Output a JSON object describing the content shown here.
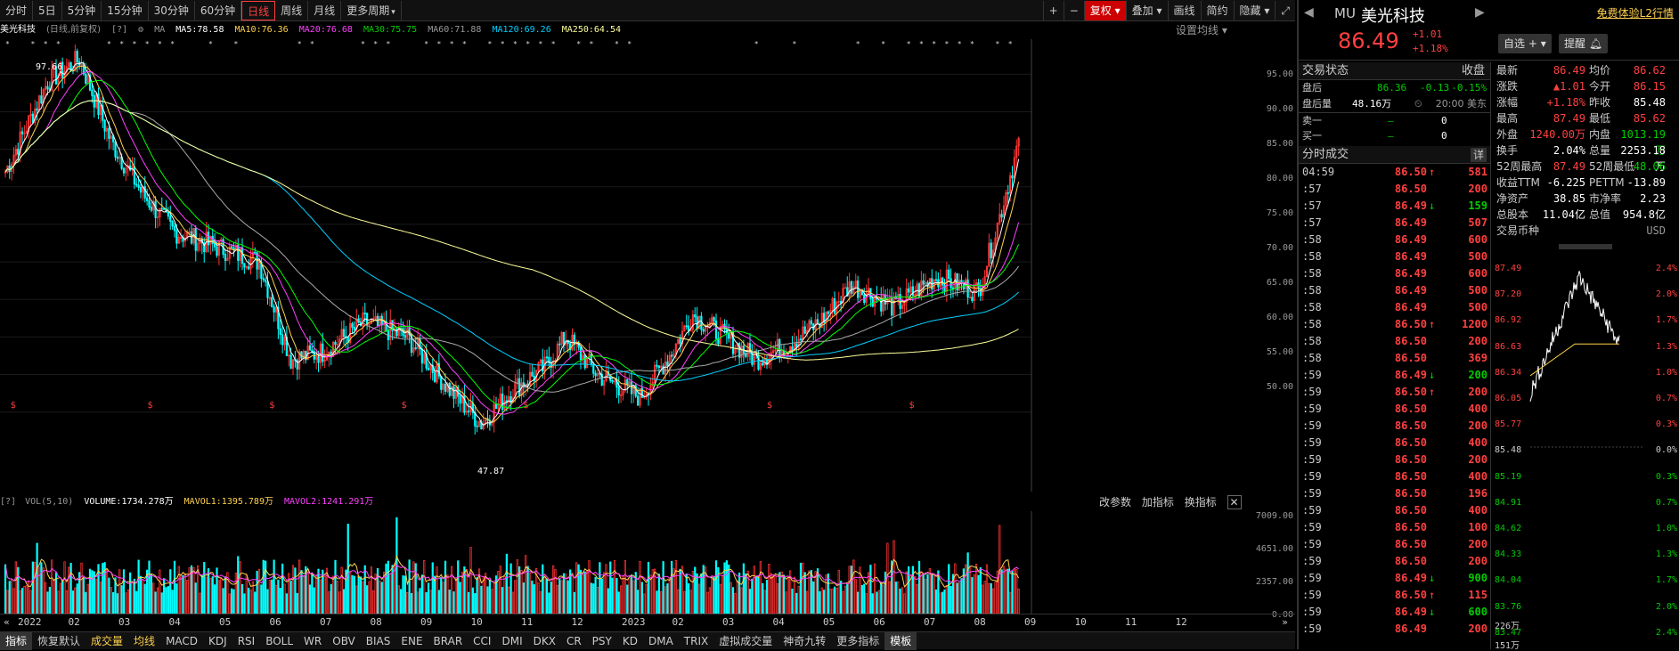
{
  "toolbar": {
    "periods": [
      "分时",
      "5日",
      "5分钟",
      "15分钟",
      "30分钟",
      "60分钟",
      "日线",
      "周线",
      "月线",
      "更多周期"
    ],
    "active_period": "日线",
    "right": [
      "+",
      "−",
      "复权",
      "叠加",
      "画线",
      "简约",
      "隐藏",
      "⤢"
    ]
  },
  "ma_bar": {
    "name": "美光科技",
    "mode": "(日线,前复权)",
    "ma_label": "MA",
    "ma5": "MA5:78.58",
    "ma10": "MA10:76.36",
    "ma20": "MA20:76.68",
    "ma30": "MA30:75.75",
    "ma60": "MA60:71.88",
    "ma120": "MA120:69.26",
    "ma250": "MA250:64.54",
    "settings": "设置均线"
  },
  "colors": {
    "ma5": "#ffffff",
    "ma10": "#ffd24d",
    "ma20": "#ff40ff",
    "ma30": "#00ff00",
    "ma60": "#aaaaaa",
    "ma120": "#00d0ff",
    "ma250": "#ffff99",
    "up": "#ff3333",
    "down": "#00ffff"
  },
  "price_axis": [
    "95.00",
    "90.00",
    "85.00",
    "80.00",
    "75.00",
    "70.00",
    "65.00",
    "60.00",
    "55.00",
    "50.00"
  ],
  "vol_axis": [
    "7009.00",
    "4651.00",
    "2357.00",
    "0.00"
  ],
  "price_annotations": {
    "high": "97.66",
    "low": "47.87"
  },
  "vol_header": {
    "label": "VOL(5,10)",
    "volume": "VOLUME:1734.278万",
    "mavol1": "MAVOL1:1395.789万",
    "mavol2": "MAVOL2:1241.291万",
    "actions": [
      "改参数",
      "加指标",
      "换指标"
    ]
  },
  "x_axis": [
    "2022",
    "02",
    "03",
    "04",
    "05",
    "06",
    "07",
    "08",
    "09",
    "10",
    "11",
    "12",
    "2023",
    "02",
    "03",
    "04",
    "05",
    "06",
    "07",
    "08",
    "09",
    "10",
    "11",
    "12"
  ],
  "bottom_tabs": [
    "指标",
    "恢复默认",
    "成交量",
    "均线",
    "MACD",
    "KDJ",
    "RSI",
    "BOLL",
    "WR",
    "OBV",
    "BIAS",
    "ENE",
    "BRAR",
    "CCI",
    "DMI",
    "DKX",
    "CR",
    "PSY",
    "KD",
    "DMA",
    "TRIX",
    "虚拟成交量",
    "神奇九转",
    "更多指标",
    "模板"
  ],
  "quote": {
    "code": "MU",
    "name": "美光科技",
    "free_trial": "免费体验L2行情",
    "price": "86.49",
    "change": "+1.01",
    "change_pct": "+1.18%",
    "btn_watch": "自选",
    "btn_alert": "提醒",
    "status_title": "交易状态",
    "status_value": "收盘",
    "after_label": "盘后",
    "after_price": "86.36",
    "after_chg": "-0.13",
    "after_pct": "-0.15%",
    "after_vol_label": "盘后量",
    "after_vol": "48.16万",
    "time_note": "20:00 美东",
    "sell1_label": "卖一",
    "sell1_price": "—",
    "sell1_vol": "0",
    "buy1_label": "买一",
    "buy1_price": "—",
    "buy1_vol": "0",
    "trades_title": "分时成交",
    "trades_detail": "详"
  },
  "stats": [
    {
      "l1": "最新",
      "v1": "86.49",
      "c1": "red",
      "l2": "均价",
      "v2": "86.62",
      "c2": "red"
    },
    {
      "l1": "涨跌",
      "v1": "▲1.01",
      "c1": "red",
      "l2": "今开",
      "v2": "86.15",
      "c2": "red"
    },
    {
      "l1": "涨幅",
      "v1": "+1.18%",
      "c1": "red",
      "l2": "昨收",
      "v2": "85.48",
      "c2": "white"
    },
    {
      "l1": "最高",
      "v1": "87.49",
      "c1": "red",
      "l2": "最低",
      "v2": "85.62",
      "c2": "red"
    },
    {
      "l1": "外盘",
      "v1": "1240.00万",
      "c1": "red",
      "l2": "内盘",
      "v2": "1013.19万",
      "c2": "green"
    },
    {
      "l1": "换手",
      "v1": "2.04%",
      "c1": "white",
      "l2": "总量",
      "v2": "2253.18万",
      "c2": "white"
    },
    {
      "l1": "52周最高",
      "v1": "87.49",
      "c1": "red",
      "l2": "52周最低",
      "v2": "48.06",
      "c2": "green"
    },
    {
      "l1": "收益TTM",
      "v1": "-6.225",
      "c1": "white",
      "l2": "PETTM",
      "v2": "-13.89",
      "c2": "white"
    },
    {
      "l1": "净资产",
      "v1": "38.85",
      "c1": "white",
      "l2": "市净率",
      "v2": "2.23",
      "c2": "white"
    },
    {
      "l1": "总股本",
      "v1": "11.04亿",
      "c1": "white",
      "l2": "总值",
      "v2": "954.8亿",
      "c2": "white"
    },
    {
      "l1": "交易币种",
      "v1": "",
      "c1": "white",
      "l2": "",
      "v2": "USD",
      "c2": "gray"
    }
  ],
  "trades": [
    {
      "t": "04:59",
      "p": "86.50",
      "a": "↑",
      "v": "581",
      "c": "red"
    },
    {
      "t": ":57",
      "p": "86.50",
      "a": "",
      "v": "200",
      "c": "red"
    },
    {
      "t": ":57",
      "p": "86.49",
      "a": "↓",
      "v": "159",
      "c": "green"
    },
    {
      "t": ":57",
      "p": "86.49",
      "a": "",
      "v": "507",
      "c": "red"
    },
    {
      "t": ":58",
      "p": "86.49",
      "a": "",
      "v": "600",
      "c": "red"
    },
    {
      "t": ":58",
      "p": "86.49",
      "a": "",
      "v": "500",
      "c": "red"
    },
    {
      "t": ":58",
      "p": "86.49",
      "a": "",
      "v": "600",
      "c": "red"
    },
    {
      "t": ":58",
      "p": "86.49",
      "a": "",
      "v": "500",
      "c": "red"
    },
    {
      "t": ":58",
      "p": "86.49",
      "a": "",
      "v": "500",
      "c": "red"
    },
    {
      "t": ":58",
      "p": "86.50",
      "a": "↑",
      "v": "1200",
      "c": "red"
    },
    {
      "t": ":58",
      "p": "86.50",
      "a": "",
      "v": "200",
      "c": "red"
    },
    {
      "t": ":58",
      "p": "86.50",
      "a": "",
      "v": "369",
      "c": "red"
    },
    {
      "t": ":59",
      "p": "86.49",
      "a": "↓",
      "v": "200",
      "c": "green"
    },
    {
      "t": ":59",
      "p": "86.50",
      "a": "↑",
      "v": "200",
      "c": "red"
    },
    {
      "t": ":59",
      "p": "86.50",
      "a": "",
      "v": "400",
      "c": "red"
    },
    {
      "t": ":59",
      "p": "86.50",
      "a": "",
      "v": "200",
      "c": "red"
    },
    {
      "t": ":59",
      "p": "86.50",
      "a": "",
      "v": "400",
      "c": "red"
    },
    {
      "t": ":59",
      "p": "86.50",
      "a": "",
      "v": "200",
      "c": "red"
    },
    {
      "t": ":59",
      "p": "86.50",
      "a": "",
      "v": "400",
      "c": "red"
    },
    {
      "t": ":59",
      "p": "86.50",
      "a": "",
      "v": "196",
      "c": "red"
    },
    {
      "t": ":59",
      "p": "86.50",
      "a": "",
      "v": "400",
      "c": "red"
    },
    {
      "t": ":59",
      "p": "86.50",
      "a": "",
      "v": "100",
      "c": "red"
    },
    {
      "t": ":59",
      "p": "86.50",
      "a": "",
      "v": "200",
      "c": "red"
    },
    {
      "t": ":59",
      "p": "86.50",
      "a": "",
      "v": "200",
      "c": "red"
    },
    {
      "t": ":59",
      "p": "86.49",
      "a": "↓",
      "v": "900",
      "c": "green"
    },
    {
      "t": ":59",
      "p": "86.50",
      "a": "↑",
      "v": "115",
      "c": "red"
    },
    {
      "t": ":59",
      "p": "86.49",
      "a": "↓",
      "v": "600",
      "c": "green"
    },
    {
      "t": ":59",
      "p": "86.49",
      "a": "",
      "v": "200",
      "c": "red"
    }
  ],
  "mini_left": [
    "87.49",
    "87.20",
    "86.92",
    "86.63",
    "86.34",
    "86.05",
    "85.77",
    "85.48",
    "85.19",
    "84.91",
    "84.62",
    "84.33",
    "84.04",
    "83.76",
    "83.47"
  ],
  "mini_right": [
    "2.4%",
    "2.0%",
    "1.7%",
    "1.3%",
    "1.0%",
    "0.7%",
    "0.3%",
    "0.0%",
    "0.3%",
    "0.7%",
    "1.0%",
    "1.3%",
    "1.7%",
    "2.0%",
    "2.4%"
  ],
  "mini_vol_label": "226万",
  "mini_vol_label2": "151万"
}
